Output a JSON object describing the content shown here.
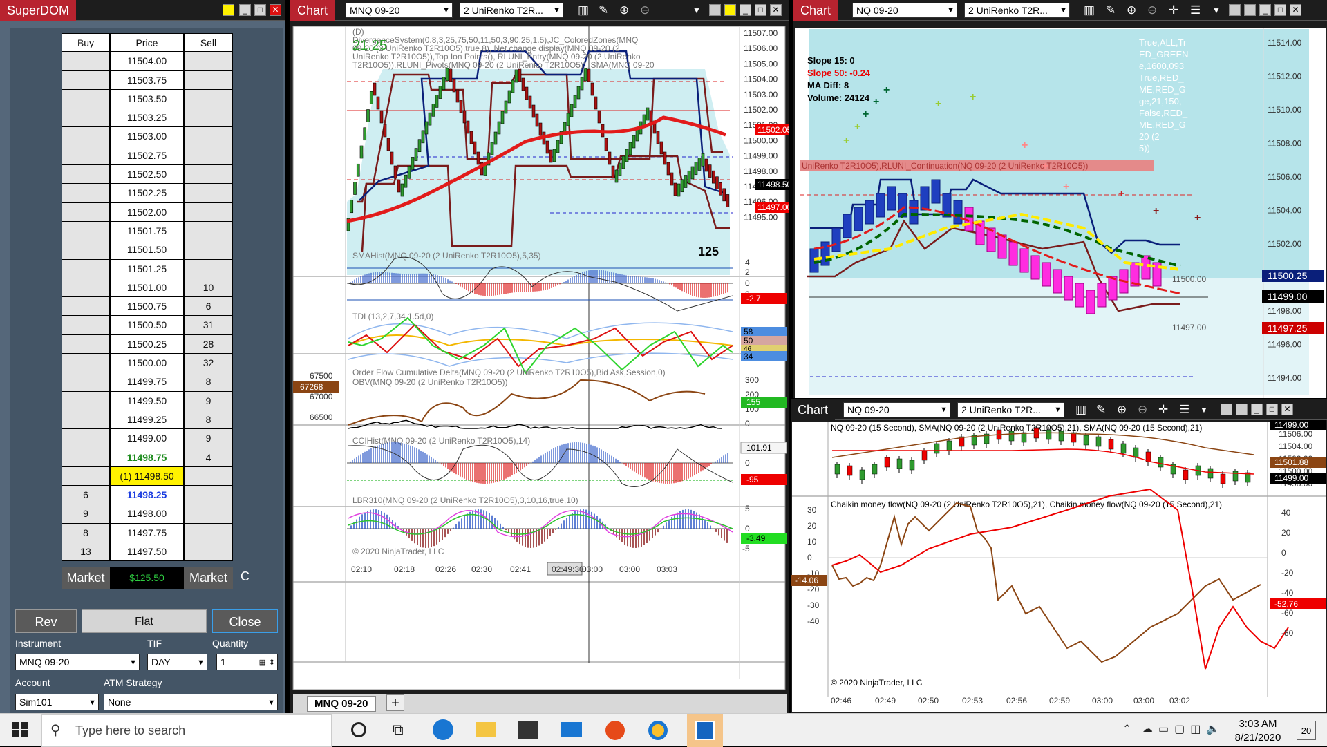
{
  "superdom": {
    "title": "SuperDOM",
    "headers": {
      "buy": "Buy",
      "price": "Price",
      "sell": "Sell"
    },
    "rows": [
      {
        "buy": "",
        "price": "11504.00",
        "sell": ""
      },
      {
        "buy": "",
        "price": "11503.75",
        "sell": ""
      },
      {
        "buy": "",
        "price": "11503.50",
        "sell": ""
      },
      {
        "buy": "",
        "price": "11503.25",
        "sell": ""
      },
      {
        "buy": "",
        "price": "11503.00",
        "sell": ""
      },
      {
        "buy": "",
        "price": "11502.75",
        "sell": ""
      },
      {
        "buy": "",
        "price": "11502.50",
        "sell": ""
      },
      {
        "buy": "",
        "price": "11502.25",
        "sell": ""
      },
      {
        "buy": "",
        "price": "11502.00",
        "sell": ""
      },
      {
        "buy": "",
        "price": "11501.75",
        "sell": ""
      },
      {
        "buy": "",
        "price": "11501.50",
        "sell": ""
      },
      {
        "buy": "",
        "price": "11501.25",
        "sell": ""
      },
      {
        "buy": "",
        "price": "11501.00",
        "sell": "10"
      },
      {
        "buy": "",
        "price": "11500.75",
        "sell": "6"
      },
      {
        "buy": "",
        "price": "11500.50",
        "sell": "31"
      },
      {
        "buy": "",
        "price": "11500.25",
        "sell": "28"
      },
      {
        "buy": "",
        "price": "11500.00",
        "sell": "32"
      },
      {
        "buy": "",
        "price": "11499.75",
        "sell": "8"
      },
      {
        "buy": "",
        "price": "11499.50",
        "sell": "9"
      },
      {
        "buy": "",
        "price": "11499.25",
        "sell": "8"
      },
      {
        "buy": "",
        "price": "11499.00",
        "sell": "9"
      },
      {
        "buy": "",
        "price": "11498.75",
        "sell": "4"
      },
      {
        "buy": "",
        "price": "(1) 11498.50",
        "sell": ""
      },
      {
        "buy": "6",
        "price": "11498.25",
        "sell": ""
      },
      {
        "buy": "9",
        "price": "11498.00",
        "sell": ""
      },
      {
        "buy": "8",
        "price": "11497.75",
        "sell": ""
      },
      {
        "buy": "13",
        "price": "11497.50",
        "sell": ""
      }
    ],
    "market_buy": "Market",
    "pnl": "$125.50",
    "market_sell": "Market",
    "c_label": "C",
    "rev": "Rev",
    "flat": "Flat",
    "close": "Close",
    "instrument_label": "Instrument",
    "instrument": "MNQ 09-20",
    "tif_label": "TIF",
    "tif": "DAY",
    "quantity_label": "Quantity",
    "quantity": "1",
    "account_label": "Account",
    "account": "Sim101",
    "atm_label": "ATM Strategy",
    "atm": "None"
  },
  "chart1": {
    "title": "Chart",
    "instrument": "MNQ 09-20",
    "series": "2 UniRenko T2R...",
    "tab": "MNQ 09-20",
    "add_tab": "+",
    "main_label": "(D) DivergenceSystem(0.8,3,25,75,50,11,50,3,90,25,1.5),JC_ColoredZones(MNQ 09-20 (2 UniRenko T2R10O5),true,8), Net change display(MNQ 09-20 (2 UniRenko T2R10O5)),Top Ion Points(), RLUNI_Entry(MNQ 09-20 (2 UniRenko T2R10O5)),RLUNI_Pivots(MNQ 09-20 (2 UniRenko T2R10O5)), SMA(MNQ 09-20 (2 UniRenko T2R10O5),200)",
    "net_change": "21.25",
    "bar_count": "125",
    "price_ticks": [
      "11507.00",
      "11506.00",
      "11505.00",
      "11504.00",
      "11503.00",
      "11502.00",
      "11501.00",
      "11500.00",
      "11499.00",
      "11498.00",
      "11497.00",
      "11496.00",
      "11495.00"
    ],
    "price_tags": {
      "red_top": "11502.05",
      "black": "11498.50",
      "red_bottom": "11497.00"
    },
    "sma_hist_label": "SMAHist(MNQ 09-20 (2 UniRenko T2R10O5),5,35)",
    "sma_ticks": [
      "4",
      "2",
      "0",
      "-2"
    ],
    "sma_tag": "-2.7",
    "tdi_label": "TDI (13,2,7,34,1.5d,0)",
    "tdi_tags": [
      "58",
      "50",
      "46",
      "34"
    ],
    "ofcd_label": "Order Flow Cumulative Delta(MNQ 09-20 (2 UniRenko T2R10O5),Bid Ask,Session,0)",
    "obv_label": "OBV(MNQ 09-20 (2 UniRenko T2R10O5))",
    "ofcd_left_ticks": [
      "67500",
      "67000",
      "66500"
    ],
    "ofcd_left_tag": "67268",
    "ofcd_right_ticks": [
      "300",
      "200",
      "100",
      "0"
    ],
    "ofcd_right_tag": "155",
    "cci_label": "CCIHist(MNQ 09-20 (2 UniRenko T2R10O5),14)",
    "cci_tags": {
      "top": "101.91",
      "bottom": "-95"
    },
    "cci_ticks": [
      "0"
    ],
    "lbr_label": "LBR310(MNQ 09-20 (2 UniRenko T2R10O5),3,10,16,true,10)",
    "lbr_ticks": [
      "5",
      "0",
      "-5"
    ],
    "lbr_tag": "-3.49",
    "copyright": "© 2020 NinjaTrader, LLC",
    "time_ticks": [
      "02:10",
      "02:18",
      "02:26",
      "02:30",
      "02:41",
      "02:49:30",
      "03:00",
      "03:00",
      "03:03"
    ]
  },
  "chart2": {
    "title": "Chart",
    "instrument": "NQ 09-20",
    "series": "2 UniRenko T2R...",
    "stats": {
      "slope15": "Slope 15: 0",
      "slope50": "Slope 50: -0.24",
      "madiff": "MA Diff:  8",
      "volume": "Volume:  24124"
    },
    "label_frag": "UniRenko T2R10O5),RLUNI_Continuation(NQ 09-20 (2 UniRenko T2R10O5))",
    "right_frags": [
      "True,ALL,Tr",
      "ED_GREEN",
      "e,1600,093",
      "True,RED_",
      "ME,RED_G",
      "ge,21,150,",
      "False,RED_",
      "ME,RED_G",
      "20 (2",
      "5))"
    ],
    "price_ticks": [
      "11514.00",
      "11512.00",
      "11510.00",
      "11508.00",
      "11506.00",
      "11504.00",
      "11502.00",
      "11500.00",
      "11498.00",
      "11496.00",
      "11494.00"
    ],
    "inner_ticks": [
      "11500.00",
      "11497.00"
    ],
    "price_tags": {
      "blue": "11500.25",
      "black": "11499.00",
      "red": "11497.25"
    }
  },
  "chart3": {
    "title": "Chart",
    "instrument": "NQ 09-20",
    "series": "2 UniRenko T2R...",
    "top_label": "NQ 09-20 (15 Second), SMA(NQ 09-20 (2 UniRenko T2R10O5),21), SMA(NQ 09-20 (15 Second),21)",
    "top_ticks": [
      "11506.00",
      "11504.00",
      "11502.00",
      "11500.00",
      "11498.00"
    ],
    "top_tags": {
      "black_top": "11499.00",
      "brown": "11501.88",
      "black": "11499.00"
    },
    "cmf_label": "Chaikin money flow(NQ 09-20 (2 UniRenko T2R10O5),21), Chaikin money flow(NQ 09-20 (15 Second),21)",
    "left_ticks": [
      "30",
      "20",
      "10",
      "0",
      "-10",
      "-20",
      "-30",
      "-40"
    ],
    "left_tag": "-14.06",
    "right_ticks": [
      "40",
      "20",
      "0",
      "-20",
      "-40",
      "-60",
      "-80"
    ],
    "right_tag": "-52.76",
    "copyright": "© 2020 NinjaTrader, LLC",
    "time_ticks": [
      "02:46",
      "02:49",
      "02:50",
      "02:53",
      "02:56",
      "02:59",
      "03:00",
      "03:00",
      "03:02"
    ]
  },
  "taskbar": {
    "search_placeholder": "Type here to search",
    "time": "3:03 AM",
    "date": "8/21/2020",
    "notifications": "20"
  }
}
